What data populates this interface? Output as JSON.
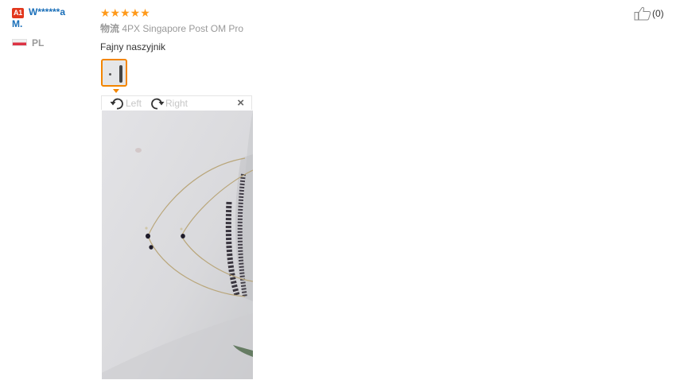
{
  "reviewer": {
    "level_badge": "A1",
    "name_line1": "W******a",
    "name_line2": "M.",
    "country": "PL"
  },
  "review": {
    "rating": 5,
    "stars_text": "★★★★★",
    "logistics_label": "物流",
    "logistics_value": "4PX Singapore Post OM Pro",
    "feedback_text": "Fajny naszyjnik"
  },
  "image_viewer": {
    "rotate_left_label": "Left",
    "rotate_right_label": "Right",
    "close_label": "×"
  },
  "helpful": {
    "count_text": "(0)"
  },
  "colors": {
    "star": "#ff9a1a",
    "link_blue": "#1a6fb9",
    "badge_red": "#e2371d",
    "thumb_border": "#f38500"
  }
}
